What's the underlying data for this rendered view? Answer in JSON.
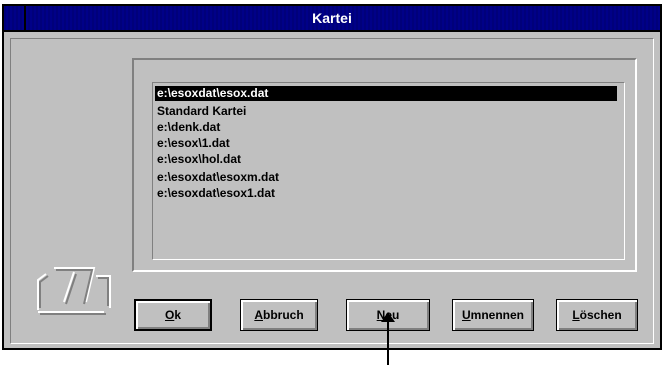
{
  "window": {
    "title": "Kartei"
  },
  "listbox": {
    "items": [
      "e:\\esoxdat\\esox.dat",
      "Standard Kartei",
      "e:\\denk.dat",
      "e:\\esox\\1.dat",
      "e:\\esox\\hol.dat",
      "e:\\esoxdat\\esoxm.dat",
      "e:\\esoxdat\\esox1.dat"
    ],
    "selected_index": 0
  },
  "buttons": {
    "ok": "Ok",
    "abbruch": "Abbruch",
    "neu": "Neu",
    "umnennen": "Umnennen",
    "loeschen": "Löschen"
  },
  "colors": {
    "titlebar": "#000080",
    "face": "#c0c0c0",
    "selection": "#000000"
  }
}
